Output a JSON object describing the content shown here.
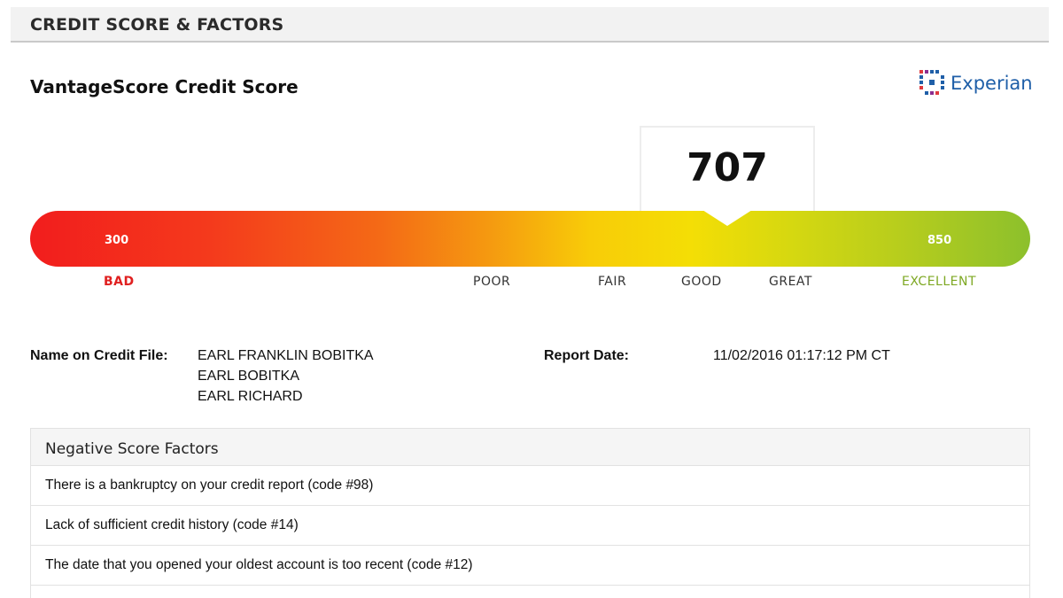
{
  "section_title": "CREDIT SCORE & FACTORS",
  "score_title": "VantageScore Credit Score",
  "brand": {
    "name": "Experian",
    "icon": "experian-logo-icon",
    "color": "#1f5fa8"
  },
  "gauge": {
    "score": "707",
    "score_value": 707,
    "min_label": "300",
    "max_label": "850",
    "min": 300,
    "max": 850,
    "colors": {
      "bad": "#f21d1d",
      "mid": "#f8cc08",
      "excellent": "#8cc02c"
    },
    "ranges": [
      {
        "label": "BAD",
        "color": "#e02020"
      },
      {
        "label": "POOR"
      },
      {
        "label": "FAIR"
      },
      {
        "label": "GOOD"
      },
      {
        "label": "GREAT"
      },
      {
        "label": "EXCELLENT",
        "color": "#7ea823"
      }
    ]
  },
  "credit_file": {
    "name_label": "Name on Credit File:",
    "names": [
      "EARL FRANKLIN BOBITKA",
      "EARL BOBITKA",
      "EARL RICHARD"
    ],
    "report_date_label": "Report Date:",
    "report_date": "11/02/2016 01:17:12 PM CT"
  },
  "negative_factors": {
    "title": "Negative Score Factors",
    "items": [
      "There is a bankruptcy on your credit report (code #98)",
      "Lack of sufficient credit history (code #14)",
      "The date that you opened your oldest account is too recent (code #12)"
    ]
  }
}
